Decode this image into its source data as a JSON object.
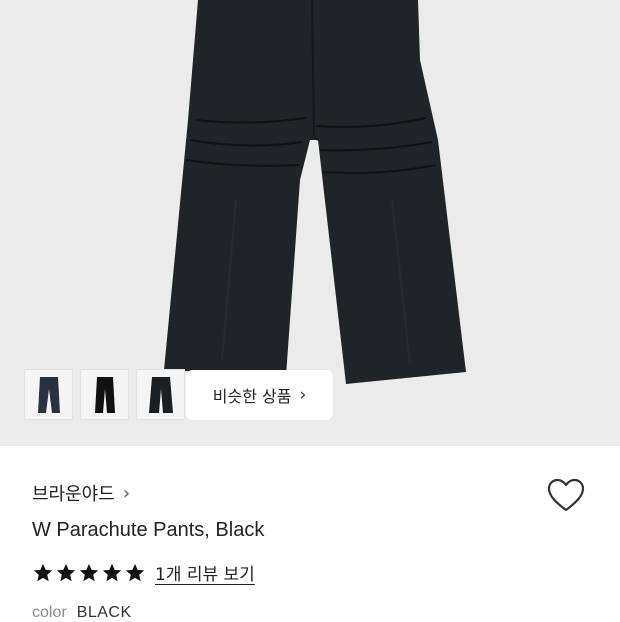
{
  "gallery": {
    "similar_button_label": "비슷한 상품",
    "similar_button_chevron": "›",
    "thumbnails": [
      "thumbnail-1",
      "thumbnail-2",
      "thumbnail-3"
    ]
  },
  "product": {
    "brand": "브라운야드",
    "brand_chevron": "›",
    "name": "W Parachute Pants, Black",
    "rating_stars": 5,
    "review_link": "1개 리뷰 보기",
    "color_label": "color",
    "color_value": "BLACK"
  },
  "icons": {
    "heart": "heart-outline-icon",
    "star": "star-filled-icon",
    "chevron": "chevron-right-icon"
  },
  "colors": {
    "hero_background": "#ebebeb",
    "pants": "#1f2426",
    "star": "#111111"
  }
}
